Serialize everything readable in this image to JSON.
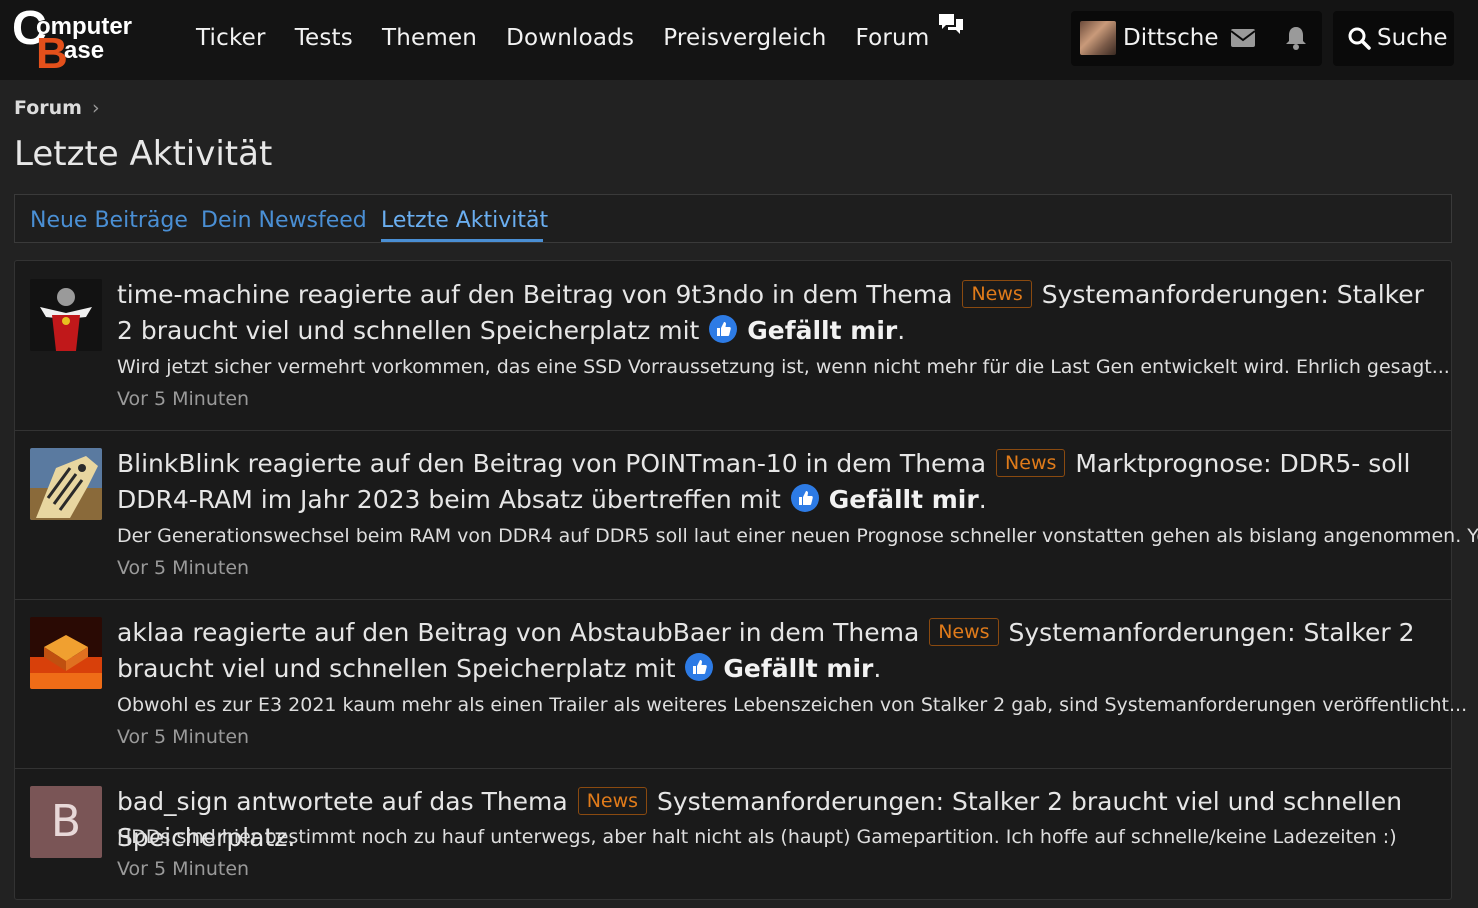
{
  "header": {
    "logo_text": "ComputerBase",
    "nav": [
      "Ticker",
      "Tests",
      "Themen",
      "Downloads",
      "Preisvergleich",
      "Forum"
    ],
    "username": "Dittsche",
    "search_label": "Suche"
  },
  "breadcrumb": {
    "root": "Forum",
    "separator": "›"
  },
  "page_title": "Letzte Aktivität",
  "tabs": [
    {
      "label": "Neue Beiträge",
      "active": false
    },
    {
      "label": "Dein Newsfeed",
      "active": false
    },
    {
      "label": "Letzte Aktivität",
      "active": true
    }
  ],
  "colors": {
    "accent": "#4a8fd4",
    "badge": "#e07b1a",
    "background": "#222222"
  },
  "activities": [
    {
      "pre": "time-machine reagierte auf den Beitrag von 9t3ndo in dem Thema",
      "badge": "News",
      "topic": "Systemanforderungen: Stalker 2 braucht viel und schnellen Speicherplatz mit",
      "reaction": "Gefällt mir",
      "post": ".",
      "snippet": "Wird jetzt sicher vermehrt vorkommen, das eine SSD Vorraussetzung ist, wenn nicht mehr für die Last Gen entwickelt wird. Ehrlich gesagt...",
      "time": "Vor 5 Minuten",
      "avatar": "red-figure"
    },
    {
      "pre": "BlinkBlink reagierte auf den Beitrag von POINTman-10 in dem Thema",
      "badge": "News",
      "topic": "Marktprognose: DDR5- soll DDR4-RAM im Jahr 2023 beim Absatz übertreffen mit",
      "reaction": "Gefällt mir",
      "post": ".",
      "snippet": "Der Generationswechsel beim RAM von DDR4 auf DDR5 soll laut einer neuen Prognose schneller vonstatten gehen als bislang angenommen. Yole...",
      "time": "Vor 5 Minuten",
      "avatar": "zebra-painting"
    },
    {
      "pre": "aklaa reagierte auf den Beitrag von AbstaubBaer in dem Thema",
      "badge": "News",
      "topic": "Systemanforderungen: Stalker 2 braucht viel und schnellen Speicherplatz mit",
      "reaction": "Gefällt mir",
      "post": ".",
      "snippet": "Obwohl es zur E3 2021 kaum mehr als einen Trailer als weiteres Lebenszeichen von Stalker 2 gab, sind Systemanforderungen veröffentlicht...",
      "time": "Vor 5 Minuten",
      "avatar": "glowing-cpu"
    },
    {
      "pre": "bad_sign antwortete auf das Thema",
      "badge": "News",
      "topic": "Systemanforderungen: Stalker 2 braucht viel und schnellen Speicherplatz.",
      "reaction": "",
      "post": "",
      "snippet": "HDDs sind hier bestimmt noch zu hauf unterwegs, aber halt nicht als (haupt) Gamepartition. Ich hoffe auf schnelle/keine Ladezeiten :)",
      "time": "Vor 5 Minuten",
      "avatar_letter": "B"
    }
  ]
}
